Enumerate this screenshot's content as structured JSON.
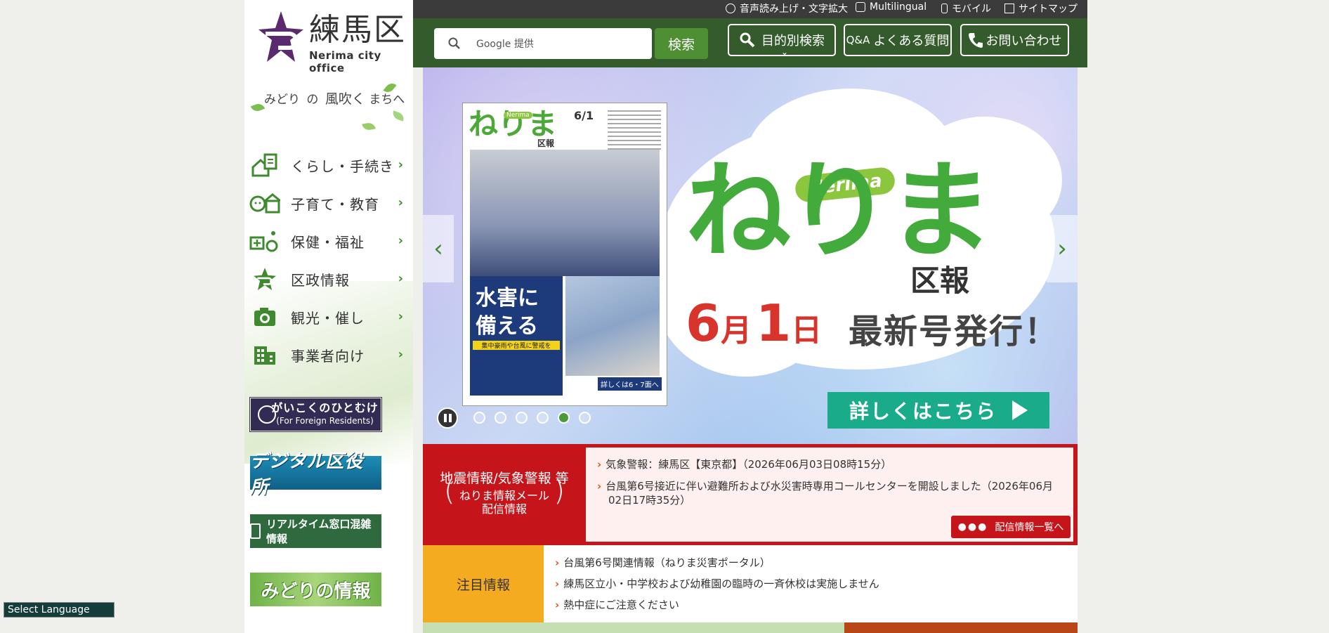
{
  "site": {
    "logo_title": "練馬区",
    "logo_subtitle": "Nerima city office",
    "tagline": [
      "みどり",
      "の",
      "風吹く",
      "まちへ"
    ]
  },
  "utility_links": [
    {
      "label": "音声読み上げ・文字拡大",
      "icon": "speaker-icon"
    },
    {
      "label": "Multilingual",
      "icon": "multilingual-icon"
    },
    {
      "label": "モバイル",
      "icon": "mobile-icon"
    },
    {
      "label": "サイトマップ",
      "icon": "sitemap-icon"
    }
  ],
  "search": {
    "placeholder": "Google 提供",
    "button_label": "検索"
  },
  "header_buttons": [
    {
      "label": "目的別検索",
      "icon": "magnifier-icon"
    },
    {
      "label": "よくある質問",
      "prefix": "Q&A"
    },
    {
      "label": "お問い合わせ",
      "icon": "phone-icon"
    }
  ],
  "nav": [
    {
      "label": "くらし・手続き",
      "icon": "house-document-icon"
    },
    {
      "label": "子育て・教育",
      "icon": "child-school-icon"
    },
    {
      "label": "保健・福祉",
      "icon": "medical-wheelchair-icon"
    },
    {
      "label": "区政情報",
      "icon": "nerima-mark-icon"
    },
    {
      "label": "観光・催し",
      "icon": "camera-icon"
    },
    {
      "label": "事業者向け",
      "icon": "building-icon"
    }
  ],
  "banners": {
    "foreign_main": "がいこくのひとむけ",
    "foreign_sub": "(For Foreign Residents)",
    "digital": "デジタル区役所",
    "realtime": "リアルタイム窓口混雑情報",
    "midori": "みどりの情報"
  },
  "language_select": "Select Language",
  "slider": {
    "cover": {
      "brand": "ねりま",
      "badge": "Nerima",
      "sub": "区報",
      "date": "6/1",
      "headline_1": "水害に",
      "headline_2": "備える",
      "warning": "集中豪雨や台風に警戒を",
      "more": "詳しくは6・7面へ"
    },
    "brand_badge": "Nerima",
    "brand_main": "ねりま",
    "brand_sub": "区報",
    "date_month_num": "6",
    "date_month_unit": "月",
    "date_day_num": "1",
    "date_day_unit": "日",
    "announce": "最新号発行！",
    "more_label": "詳しくはこちら",
    "dots_total": 6,
    "active_dot": 5
  },
  "alert": {
    "title": "地震情報/気象警報 等",
    "sub_1": "ねりま情報メール",
    "sub_2": "配信情報",
    "items": [
      "気象警報：練馬区【東京都】（2026年06月03日08時15分）",
      "台風第6号接近に伴い避難所および水災害時専用コールセンターを開設しました（2026年06月",
      "02日17時35分）"
    ],
    "list_button": "配信情報一覧へ"
  },
  "featured": {
    "label": "注目情報",
    "items": [
      "台風第6号関連情報（ねりま災害ポータル）",
      "練馬区立小・中学校および幼稚園の臨時の一斉休校は実施しません",
      "熱中症にご注意ください"
    ]
  },
  "colors": {
    "header_green": "#345b2c",
    "accent_green": "#4f8f34",
    "alert_red": "#c6141b",
    "featured_orange": "#f5ab1f",
    "brand_purple": "#5b2a6e"
  }
}
